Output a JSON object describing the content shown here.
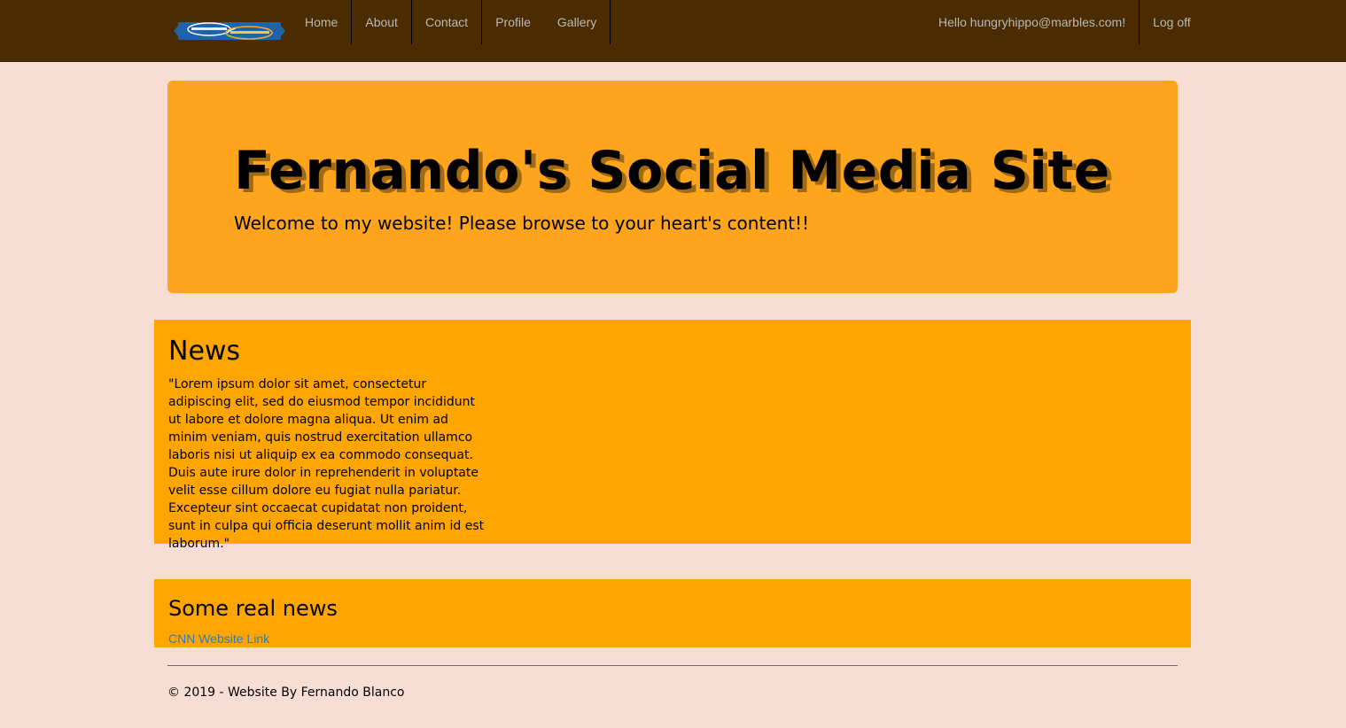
{
  "navbar": {
    "logo_icon": "site-logo",
    "links": [
      {
        "label": "Home"
      },
      {
        "label": "About"
      },
      {
        "label": "Contact"
      },
      {
        "label": "Profile"
      },
      {
        "label": "Gallery"
      }
    ],
    "greeting": "Hello hungryhippo@marbles.com!",
    "logoff_label": "Log off"
  },
  "jumbotron": {
    "title": "Fernando's Social Media Site",
    "lead": "Welcome to my website! Please browse to your heart's content!!"
  },
  "news": {
    "heading": "News",
    "body": "\"Lorem ipsum dolor sit amet, consectetur adipiscing elit, sed do eiusmod tempor incididunt ut labore et dolore magna aliqua. Ut enim ad minim veniam, quis nostrud exercitation ullamco laboris nisi ut aliquip ex ea commodo consequat. Duis aute irure dolor in reprehenderit in voluptate velit esse cillum dolore eu fugiat nulla pariatur. Excepteur sint occaecat cupidatat non proident, sunt in culpa qui officia deserunt mollit anim id est laborum.\""
  },
  "real_news": {
    "heading": "Some real news",
    "link_label": "CNN Website Link"
  },
  "footer": {
    "copyright": "© 2019 - Website By Fernando Blanco"
  },
  "colors": {
    "navbar_bg": "#4a2c00",
    "page_bg": "#f8ddd5",
    "jumbotron_bg": "#ffa41d",
    "panel_bg": "#ffa500",
    "link": "#337ab7",
    "nav_text": "#b9b9b9"
  }
}
